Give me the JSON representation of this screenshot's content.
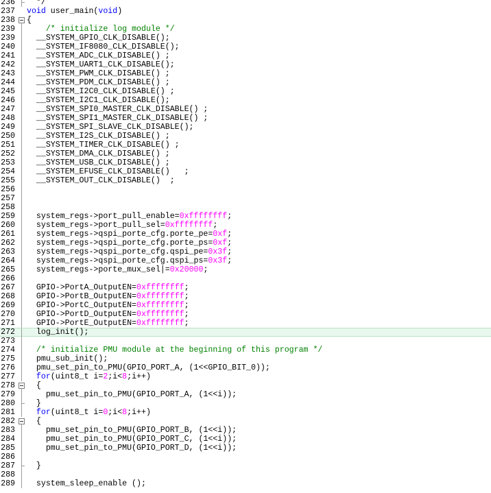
{
  "editor": {
    "colors": {
      "keyword": "#0000ff",
      "number": "#ff00ff",
      "comment": "#008000",
      "text": "#000000",
      "highlight_line": "#e9f8ee"
    },
    "highlighted_line": 272,
    "lines": [
      {
        "n": "236",
        "fold": "end",
        "segs": [
          [
            "t",
            "  */"
          ]
        ]
      },
      {
        "n": "237",
        "fold": "",
        "segs": [
          [
            "k",
            "void"
          ],
          [
            "t",
            " user_main("
          ],
          [
            "k",
            "void"
          ],
          [
            "t",
            ")"
          ]
        ]
      },
      {
        "n": "238",
        "fold": "box",
        "segs": [
          [
            "t",
            "{"
          ]
        ]
      },
      {
        "n": "239",
        "fold": "line",
        "segs": [
          [
            "t",
            "    "
          ],
          [
            "c",
            "/* initialize log module */"
          ]
        ]
      },
      {
        "n": "239",
        "fold": "line",
        "segs": [
          [
            "t",
            "  __SYSTEM_GPIO_CLK_DISABLE();"
          ]
        ]
      },
      {
        "n": "240",
        "fold": "line",
        "segs": [
          [
            "t",
            "  __SYSTEM_IF8080_CLK_DISABLE();"
          ]
        ]
      },
      {
        "n": "241",
        "fold": "line",
        "segs": [
          [
            "t",
            "  __SYSTEM_ADC_CLK_DISABLE() ;"
          ]
        ]
      },
      {
        "n": "242",
        "fold": "line",
        "segs": [
          [
            "t",
            "  __SYSTEM_UART1_CLK_DISABLE();"
          ]
        ]
      },
      {
        "n": "243",
        "fold": "line",
        "segs": [
          [
            "t",
            "  __SYSTEM_PWM_CLK_DISABLE() ;"
          ]
        ]
      },
      {
        "n": "244",
        "fold": "line",
        "segs": [
          [
            "t",
            "  __SYSTEM_PDM_CLK_DISABLE() ;"
          ]
        ]
      },
      {
        "n": "245",
        "fold": "line",
        "segs": [
          [
            "t",
            "  __SYSTEM_I2C0_CLK_DISABLE() ;"
          ]
        ]
      },
      {
        "n": "246",
        "fold": "line",
        "segs": [
          [
            "t",
            "  __SYSTEM_I2C1_CLK_DISABLE();"
          ]
        ]
      },
      {
        "n": "247",
        "fold": "line",
        "segs": [
          [
            "t",
            "  __SYSTEM_SPI0_MASTER_CLK_DISABLE() ;"
          ]
        ]
      },
      {
        "n": "248",
        "fold": "line",
        "segs": [
          [
            "t",
            "  __SYSTEM_SPI1_MASTER_CLK_DISABLE() ;"
          ]
        ]
      },
      {
        "n": "249",
        "fold": "line",
        "segs": [
          [
            "t",
            "  __SYSTEM_SPI_SLAVE_CLK_DISABLE();"
          ]
        ]
      },
      {
        "n": "250",
        "fold": "line",
        "segs": [
          [
            "t",
            "  __SYSTEM_I2S_CLK_DISABLE() ;"
          ]
        ]
      },
      {
        "n": "251",
        "fold": "line",
        "segs": [
          [
            "t",
            "  __SYSTEM_TIMER_CLK_DISABLE() ;"
          ]
        ]
      },
      {
        "n": "252",
        "fold": "line",
        "segs": [
          [
            "t",
            "  __SYSTEM_DMA_CLK_DISABLE() ;"
          ]
        ]
      },
      {
        "n": "253",
        "fold": "line",
        "segs": [
          [
            "t",
            "  __SYSTEM_USB_CLK_DISABLE() ;"
          ]
        ]
      },
      {
        "n": "254",
        "fold": "line",
        "segs": [
          [
            "t",
            "  __SYSTEM_EFUSE_CLK_DISABLE()   ;"
          ]
        ]
      },
      {
        "n": "255",
        "fold": "line",
        "segs": [
          [
            "t",
            "  __SYSTEM_OUT_CLK_DISABLE()  ;"
          ]
        ]
      },
      {
        "n": "256",
        "fold": "line",
        "segs": []
      },
      {
        "n": "257",
        "fold": "line",
        "segs": []
      },
      {
        "n": "258",
        "fold": "line",
        "segs": []
      },
      {
        "n": "259",
        "fold": "line",
        "segs": [
          [
            "t",
            "  system_regs->port_pull_enable="
          ],
          [
            "u",
            "0xffffffff"
          ],
          [
            "t",
            ";"
          ]
        ]
      },
      {
        "n": "260",
        "fold": "line",
        "segs": [
          [
            "t",
            "  system_regs->port_pull_sel="
          ],
          [
            "u",
            "0xffffffff"
          ],
          [
            "t",
            ";"
          ]
        ]
      },
      {
        "n": "261",
        "fold": "line",
        "segs": [
          [
            "t",
            "  system_regs->qspi_porte_cfg.porte_pe="
          ],
          [
            "u",
            "0xf"
          ],
          [
            "t",
            ";"
          ]
        ]
      },
      {
        "n": "262",
        "fold": "line",
        "segs": [
          [
            "t",
            "  system_regs->qspi_porte_cfg.porte_ps="
          ],
          [
            "u",
            "0xf"
          ],
          [
            "t",
            ";"
          ]
        ]
      },
      {
        "n": "263",
        "fold": "line",
        "segs": [
          [
            "t",
            "  system_regs->qspi_porte_cfg.qspi_pe="
          ],
          [
            "u",
            "0x3f"
          ],
          [
            "t",
            ";"
          ]
        ]
      },
      {
        "n": "264",
        "fold": "line",
        "segs": [
          [
            "t",
            "  system_regs->qspi_porte_cfg.qspi_ps="
          ],
          [
            "u",
            "0x3f"
          ],
          [
            "t",
            ";"
          ]
        ]
      },
      {
        "n": "265",
        "fold": "line",
        "segs": [
          [
            "t",
            "  system_regs->porte_mux_sel|="
          ],
          [
            "u",
            "0x20000"
          ],
          [
            "t",
            ";"
          ]
        ]
      },
      {
        "n": "266",
        "fold": "line",
        "segs": []
      },
      {
        "n": "267",
        "fold": "line",
        "segs": [
          [
            "t",
            "  GPIO->PortA_OutputEN="
          ],
          [
            "u",
            "0xffffffff"
          ],
          [
            "t",
            ";"
          ]
        ]
      },
      {
        "n": "268",
        "fold": "line",
        "segs": [
          [
            "t",
            "  GPIO->PortB_OutputEN="
          ],
          [
            "u",
            "0xffffffff"
          ],
          [
            "t",
            ";"
          ]
        ]
      },
      {
        "n": "269",
        "fold": "line",
        "segs": [
          [
            "t",
            "  GPIO->PortC_OutputEN="
          ],
          [
            "u",
            "0xffffffff"
          ],
          [
            "t",
            ";"
          ]
        ]
      },
      {
        "n": "270",
        "fold": "line",
        "segs": [
          [
            "t",
            "  GPIO->PortD_OutputEN="
          ],
          [
            "u",
            "0xffffffff"
          ],
          [
            "t",
            ";"
          ]
        ]
      },
      {
        "n": "271",
        "fold": "line",
        "segs": [
          [
            "t",
            "  GPIO->PortE_OutputEN="
          ],
          [
            "u",
            "0xffffffff"
          ],
          [
            "t",
            ";"
          ]
        ]
      },
      {
        "n": "272",
        "fold": "line",
        "segs": [
          [
            "t",
            "  log_init();"
          ]
        ]
      },
      {
        "n": "273",
        "fold": "line",
        "segs": []
      },
      {
        "n": "274",
        "fold": "line",
        "segs": [
          [
            "t",
            "  "
          ],
          [
            "c",
            "/* initialize PMU module at the beginning of this program */"
          ]
        ]
      },
      {
        "n": "275",
        "fold": "line",
        "segs": [
          [
            "t",
            "  pmu_sub_init();"
          ]
        ]
      },
      {
        "n": "276",
        "fold": "line",
        "segs": [
          [
            "t",
            "  pmu_set_pin_to_PMU(GPIO_PORT_A, (1<<GPIO_BIT_0));"
          ]
        ]
      },
      {
        "n": "277",
        "fold": "line",
        "segs": [
          [
            "t",
            "  "
          ],
          [
            "k",
            "for"
          ],
          [
            "t",
            "(uint8_t i="
          ],
          [
            "u",
            "2"
          ],
          [
            "t",
            ";i<"
          ],
          [
            "u",
            "8"
          ],
          [
            "t",
            ";i++)"
          ]
        ]
      },
      {
        "n": "278",
        "fold": "box",
        "segs": [
          [
            "t",
            "  {"
          ]
        ]
      },
      {
        "n": "279",
        "fold": "line",
        "segs": [
          [
            "t",
            "    pmu_set_pin_to_PMU(GPIO_PORT_A, (1<<i));"
          ]
        ]
      },
      {
        "n": "280",
        "fold": "end",
        "segs": [
          [
            "t",
            "  }"
          ]
        ]
      },
      {
        "n": "281",
        "fold": "line",
        "segs": [
          [
            "t",
            "  "
          ],
          [
            "k",
            "for"
          ],
          [
            "t",
            "(uint8_t i="
          ],
          [
            "u",
            "0"
          ],
          [
            "t",
            ";i<"
          ],
          [
            "u",
            "8"
          ],
          [
            "t",
            ";i++)"
          ]
        ]
      },
      {
        "n": "282",
        "fold": "box",
        "segs": [
          [
            "t",
            "  {"
          ]
        ]
      },
      {
        "n": "283",
        "fold": "line",
        "segs": [
          [
            "t",
            "    pmu_set_pin_to_PMU(GPIO_PORT_B, (1<<i));"
          ]
        ]
      },
      {
        "n": "284",
        "fold": "line",
        "segs": [
          [
            "t",
            "    pmu_set_pin_to_PMU(GPIO_PORT_C, (1<<i));"
          ]
        ]
      },
      {
        "n": "285",
        "fold": "line",
        "segs": [
          [
            "t",
            "    pmu_set_pin_to_PMU(GPIO_PORT_D, (1<<i));"
          ]
        ]
      },
      {
        "n": "286",
        "fold": "line",
        "segs": []
      },
      {
        "n": "287",
        "fold": "end",
        "segs": [
          [
            "t",
            "  }"
          ]
        ]
      },
      {
        "n": "288",
        "fold": "line",
        "segs": []
      },
      {
        "n": "289",
        "fold": "line",
        "segs": [
          [
            "t",
            "  system_sleep_enable ();"
          ]
        ]
      }
    ]
  }
}
